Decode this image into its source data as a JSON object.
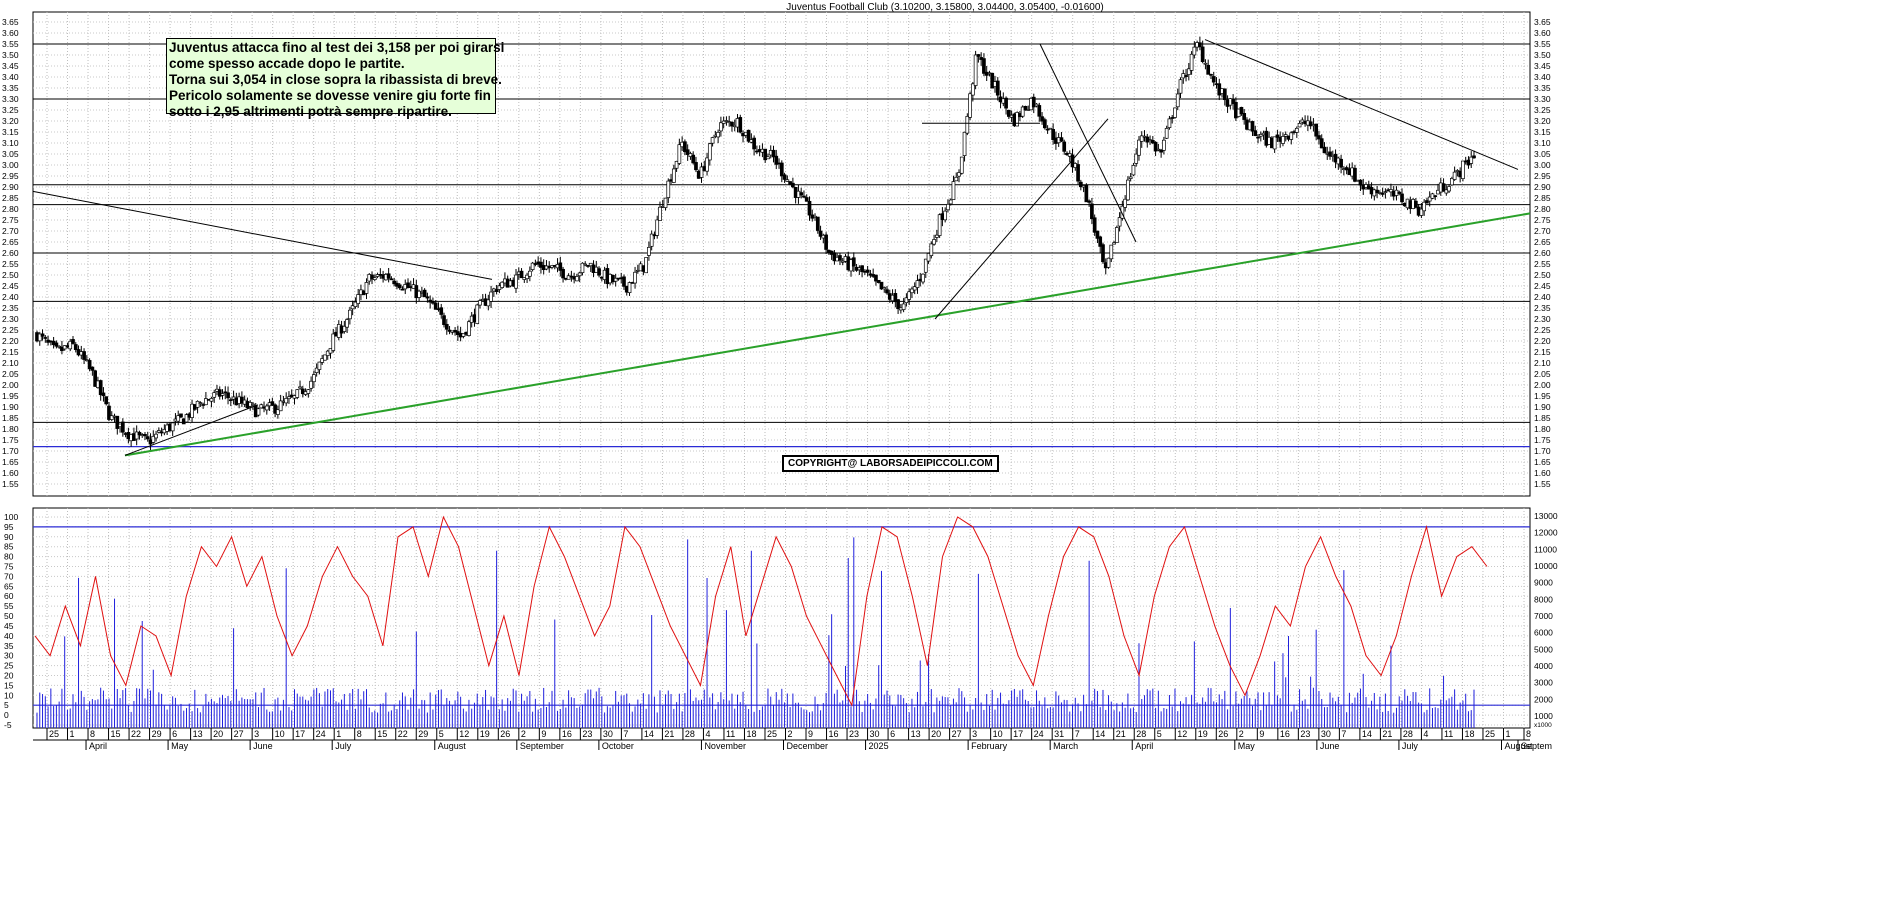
{
  "chart_title": "Juventus  Football Club (3.10200, 3.15800, 3.04400, 3.05400, -0.01600)",
  "annotation": {
    "lines": [
      "Juventus attacca fino al test dei 3,158 per poi girarsi",
      "come spesso accade dopo le partite.",
      "Torna sui 3,054 in close sopra la ribassista di breve.",
      "Pericolo solamente se dovesse  venire giu forte fin",
      "sotto i 2,95 altrimenti potrà sempre ripartire."
    ]
  },
  "copyright": "COPYRIGHT@ LABORSADEIPICCOLI.COM",
  "colors": {
    "candle_up": "#ffffff",
    "candle_down": "#000000",
    "trendline_green": "#2aa12a",
    "support_blue": "#2b2bd6",
    "rsi_red": "#e01010",
    "volume_blue": "#2020dd"
  },
  "chart_data": [
    {
      "type": "candlestick",
      "title": "Juventus  Football Club (3.10200, 3.15800, 3.04400, 3.05400, -0.01600)",
      "last_bar": {
        "open": 3.102,
        "high": 3.158,
        "low": 3.044,
        "close": 3.054,
        "change": -0.016
      },
      "ylim": [
        1.5,
        3.68
      ],
      "y_ticks": [
        "1.55",
        "1.60",
        "1.65",
        "1.70",
        "1.75",
        "1.80",
        "1.85",
        "1.90",
        "1.95",
        "2.00",
        "2.05",
        "2.10",
        "2.15",
        "2.20",
        "2.25",
        "2.30",
        "2.35",
        "2.40",
        "2.45",
        "2.50",
        "2.55",
        "2.60",
        "2.65",
        "2.70",
        "2.75",
        "2.80",
        "2.85",
        "2.90",
        "2.95",
        "3.00",
        "3.05",
        "3.10",
        "3.15",
        "3.20",
        "3.25",
        "3.30",
        "3.35",
        "3.40",
        "3.45",
        "3.50",
        "3.55",
        "3.60",
        "3.65"
      ],
      "x_day_labels": [
        "25",
        "1",
        "8",
        "15",
        "22",
        "29",
        "6",
        "13",
        "20",
        "27",
        "3",
        "10",
        "17",
        "24",
        "1",
        "8",
        "15",
        "22",
        "29",
        "5",
        "12",
        "19",
        "26",
        "2",
        "9",
        "16",
        "23",
        "30",
        "7",
        "14",
        "21",
        "28",
        "4",
        "11",
        "18",
        "25",
        "2",
        "9",
        "16",
        "23",
        "30",
        "6",
        "13",
        "20",
        "27",
        "3",
        "10",
        "17",
        "24",
        "31",
        "7",
        "14",
        "21",
        "28",
        "5",
        "12",
        "19",
        "26",
        "2",
        "9",
        "16",
        "23",
        "30",
        "7",
        "14",
        "21",
        "28",
        "4",
        "11",
        "18",
        "25",
        "1",
        "8"
      ],
      "x_month_labels": [
        "April",
        "May",
        "June",
        "July",
        "August",
        "September",
        "October",
        "November",
        "December",
        "2025",
        "February",
        "March",
        "April",
        "May",
        "June",
        "July",
        "August",
        "Septem"
      ],
      "grid": true,
      "horizontal_levels": [
        3.55,
        3.3,
        2.91,
        2.82,
        2.6,
        2.38,
        1.83
      ],
      "support_line_blue": 1.72,
      "trendlines": [
        {
          "name": "long-term support",
          "from": [
            "2024-04-22",
            1.68
          ],
          "to": [
            "2025-08-29",
            2.78
          ]
        },
        {
          "name": "descending",
          "from": [
            "2024-04-01",
            2.88
          ],
          "to": [
            "2024-09-02",
            2.48
          ]
        },
        {
          "name": "short-term bearish",
          "from": [
            "2025-05-19",
            3.57
          ],
          "to": [
            "2025-08-29",
            2.98
          ]
        }
      ],
      "closes_approx": [
        2.23,
        2.15,
        2.18,
        2.05,
        1.85,
        1.78,
        1.74,
        1.8,
        1.85,
        1.93,
        1.96,
        1.92,
        1.88,
        1.9,
        1.94,
        2.03,
        2.2,
        2.32,
        2.48,
        2.5,
        2.45,
        2.4,
        2.3,
        2.22,
        2.35,
        2.45,
        2.48,
        2.55,
        2.53,
        2.5,
        2.55,
        2.48,
        2.45,
        2.55,
        2.85,
        3.1,
        2.95,
        3.18,
        3.2,
        3.08,
        3.03,
        2.9,
        2.78,
        2.6,
        2.55,
        2.5,
        2.42,
        2.35,
        2.5,
        2.75,
        2.95,
        3.5,
        3.35,
        3.2,
        3.3,
        3.15,
        3.05,
        2.85,
        2.5,
        2.85,
        3.15,
        3.05,
        3.35,
        3.55,
        3.35,
        3.25,
        3.15,
        3.1,
        3.15,
        3.2,
        3.05,
        3.0,
        2.9,
        2.88,
        2.85,
        2.8,
        2.88,
        2.95,
        3.05
      ]
    },
    {
      "type": "line",
      "name": "oscillator",
      "ylim": [
        -5,
        105
      ],
      "y_ticks": [
        "-5",
        "0",
        "5",
        "10",
        "15",
        "20",
        "25",
        "30",
        "35",
        "40",
        "45",
        "50",
        "55",
        "60",
        "65",
        "70",
        "75",
        "80",
        "85",
        "90",
        "95",
        "100"
      ],
      "levels": [
        95,
        5
      ],
      "values_approx": [
        40,
        30,
        55,
        35,
        70,
        30,
        15,
        45,
        40,
        20,
        60,
        85,
        75,
        90,
        65,
        80,
        50,
        30,
        45,
        70,
        85,
        70,
        60,
        35,
        90,
        95,
        70,
        100,
        85,
        55,
        25,
        50,
        20,
        65,
        95,
        80,
        60,
        40,
        55,
        95,
        85,
        65,
        45,
        30,
        15,
        60,
        85,
        40,
        65,
        90,
        75,
        50,
        35,
        20,
        5,
        60,
        95,
        90,
        60,
        25,
        80,
        100,
        95,
        80,
        55,
        30,
        15,
        50,
        80,
        95,
        90,
        70,
        40,
        20,
        60,
        85,
        95,
        70,
        45,
        25,
        10,
        30,
        55,
        45,
        75,
        90,
        70,
        55,
        30,
        20,
        40,
        70,
        95,
        60,
        80,
        85,
        75
      ]
    },
    {
      "type": "bar",
      "name": "volume",
      "unit": "x1000",
      "ylim": [
        0,
        13500
      ],
      "y_ticks": [
        "1000",
        "2000",
        "3000",
        "4000",
        "5000",
        "6000",
        "7000",
        "8000",
        "9000",
        "10000",
        "11000",
        "12000",
        "13000"
      ]
    }
  ]
}
